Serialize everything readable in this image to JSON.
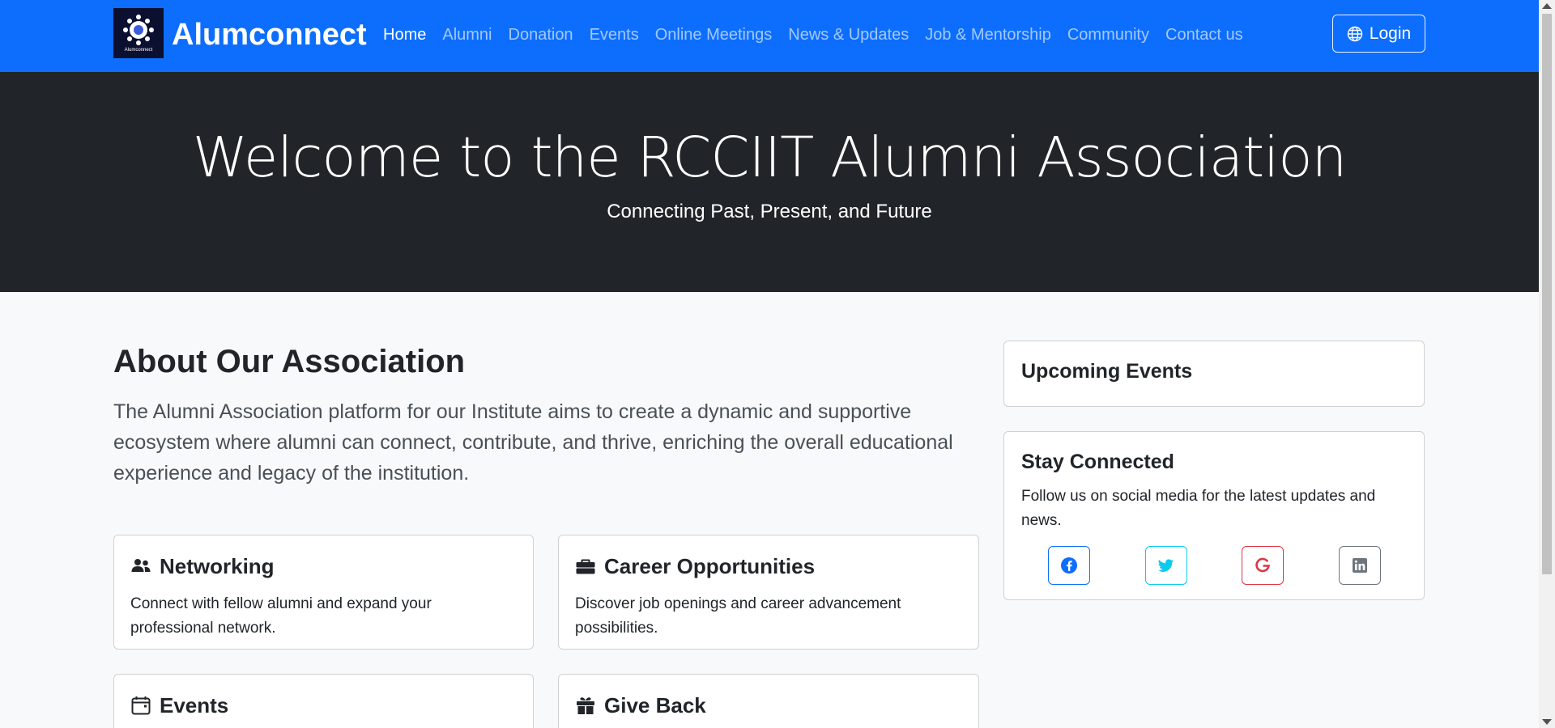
{
  "navbar": {
    "brand_name": "Alumconnect",
    "logo_text": "Alumconnect",
    "links": [
      "Home",
      "Alumni",
      "Donation",
      "Events",
      "Online Meetings",
      "News & Updates",
      "Job & Mentorship",
      "Community",
      "Contact us"
    ],
    "active": "Home",
    "login_label": "Login",
    "color": "#0d6efd"
  },
  "hero": {
    "title": "Welcome to the RCCIIT Alumni Association",
    "subtitle": "Connecting Past, Present, and Future",
    "color": "#212529"
  },
  "about": {
    "title": "About Our Association",
    "text": "The Alumni Association platform for our Institute aims to create a dynamic and supportive ecosystem where alumni can connect, contribute, and thrive, enriching the overall educational experience and legacy of the institution."
  },
  "features": [
    {
      "icon": "people-icon",
      "title": "Networking",
      "text": "Connect with fellow alumni and expand your professional network."
    },
    {
      "icon": "briefcase-icon",
      "title": "Career Opportunities",
      "text": "Discover job openings and career advancement possibilities."
    },
    {
      "icon": "calendar-icon",
      "title": "Events",
      "text": ""
    },
    {
      "icon": "gift-icon",
      "title": "Give Back",
      "text": ""
    }
  ],
  "sidebar": {
    "upcoming_events_title": "Upcoming Events",
    "stay_connected_title": "Stay Connected",
    "stay_connected_text": "Follow us on social media for the latest updates and news.",
    "social": [
      {
        "icon": "facebook-icon",
        "color": "#0d6efd"
      },
      {
        "icon": "twitter-icon",
        "color": "#0dcaf0"
      },
      {
        "icon": "google-icon",
        "color": "#dc3545"
      },
      {
        "icon": "linkedin-icon",
        "color": "#6c757d"
      }
    ]
  }
}
